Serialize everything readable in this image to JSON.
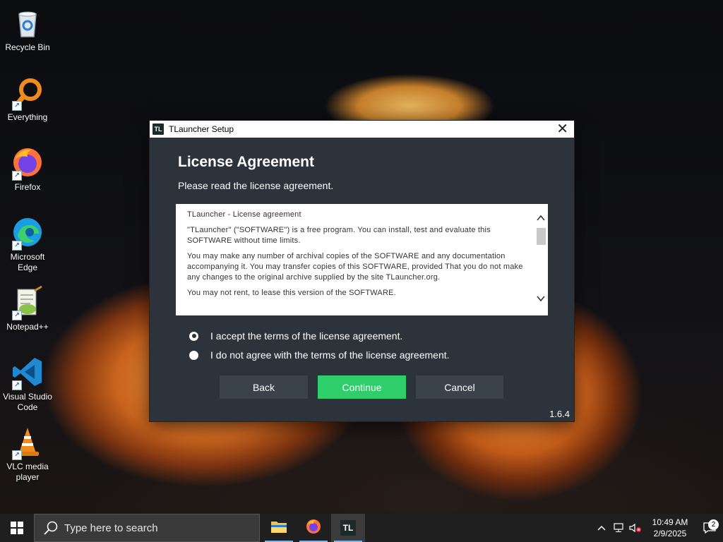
{
  "desktop": {
    "icons": [
      {
        "label": "Recycle Bin"
      },
      {
        "label": "Everything"
      },
      {
        "label": "Firefox"
      },
      {
        "label": "Microsoft Edge"
      },
      {
        "label": "Notepad++"
      },
      {
        "label": "Visual Studio Code"
      },
      {
        "label": "VLC media player"
      }
    ]
  },
  "dialog": {
    "logo_text": "TL",
    "title": "TLauncher Setup",
    "close_glyph": "✕",
    "heading": "License Agreement",
    "subheading": "Please read the license agreement.",
    "license": {
      "paragraphs": [
        "TLauncher - License agreement",
        "\"TLauncher\" (\"SOFTWARE\") is a free program. You can install, test and evaluate this SOFTWARE without time limits.",
        "You may make any number of archival copies of the SOFTWARE and any documentation accompanying it. You may transfer copies of this SOFTWARE, provided That you do not make any changes to the original archive supplied by the site TLauncher.org.",
        "You may not rent, to lease this version of the SOFTWARE."
      ]
    },
    "options": [
      {
        "label": "I accept the terms of the license agreement.",
        "checked": true
      },
      {
        "label": "I do not agree with the terms of the license agreement.",
        "checked": false
      }
    ],
    "buttons": {
      "back": "Back",
      "continue": "Continue",
      "cancel": "Cancel"
    },
    "version": "1.6.4"
  },
  "taskbar": {
    "search_placeholder": "Type here to search",
    "apps": [
      {
        "name": "file-explorer"
      },
      {
        "name": "firefox"
      },
      {
        "name": "tlauncher",
        "label": "TL",
        "active": true
      }
    ],
    "clock": {
      "time": "10:49 AM",
      "date": "2/9/2025"
    },
    "notification_count": "2"
  },
  "colors": {
    "dialog_bg": "#2c333a",
    "continue_green": "#2ecf6a",
    "button_dark": "#3a434c",
    "taskbar_bg": "#1f1f1f"
  }
}
